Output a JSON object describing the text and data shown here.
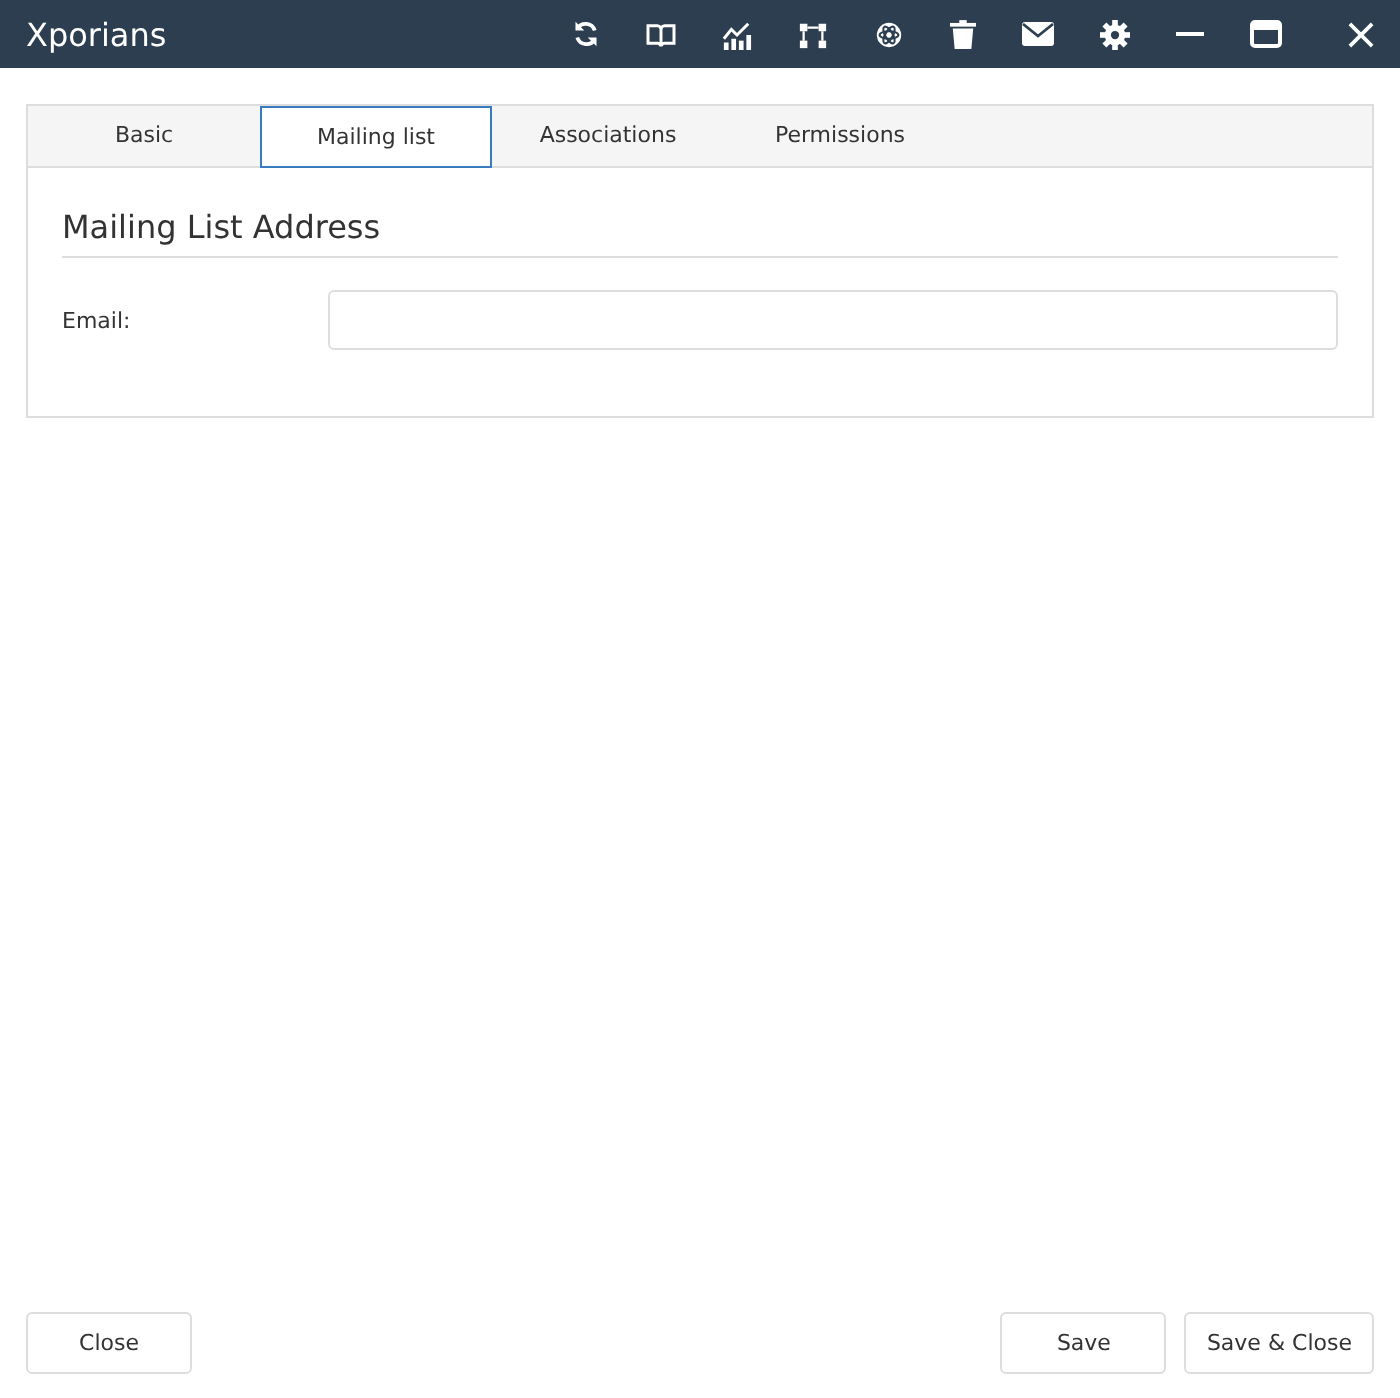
{
  "window": {
    "title": "Xporians"
  },
  "tabs": [
    {
      "label": "Basic",
      "selected": false
    },
    {
      "label": "Mailing list",
      "selected": true
    },
    {
      "label": "Associations",
      "selected": false
    },
    {
      "label": "Permissions",
      "selected": false
    }
  ],
  "section": {
    "title": "Mailing List Address"
  },
  "fields": [
    {
      "label": "Email:"
    }
  ],
  "footer": {
    "left_buttons": [
      "Close"
    ],
    "right_buttons": [
      "Save",
      "Save & Close"
    ]
  }
}
